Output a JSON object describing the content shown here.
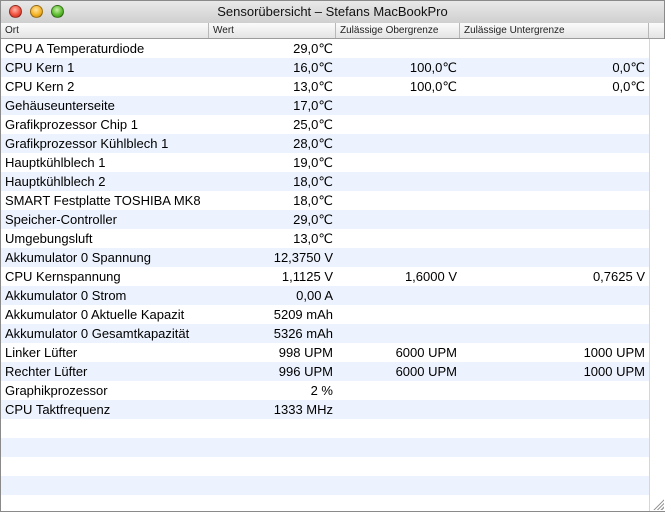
{
  "window": {
    "title": "Sensorübersicht – Stefans MacBookPro"
  },
  "columns": {
    "ort": "Ort",
    "wert": "Wert",
    "max": "Zulässige Obergrenze",
    "min": "Zulässige Untergrenze"
  },
  "rows": [
    {
      "name": "CPU A Temperaturdiode",
      "value": "29,0℃",
      "max": "",
      "min": ""
    },
    {
      "name": "CPU Kern 1",
      "value": "16,0℃",
      "max": "100,0℃",
      "min": "0,0℃"
    },
    {
      "name": "CPU Kern 2",
      "value": "13,0℃",
      "max": "100,0℃",
      "min": "0,0℃"
    },
    {
      "name": "Gehäuseunterseite",
      "value": "17,0℃",
      "max": "",
      "min": ""
    },
    {
      "name": "Grafikprozessor Chip 1",
      "value": "25,0℃",
      "max": "",
      "min": ""
    },
    {
      "name": "Grafikprozessor Kühlblech 1",
      "value": "28,0℃",
      "max": "",
      "min": ""
    },
    {
      "name": "Hauptkühlblech 1",
      "value": "19,0℃",
      "max": "",
      "min": ""
    },
    {
      "name": "Hauptkühlblech 2",
      "value": "18,0℃",
      "max": "",
      "min": ""
    },
    {
      "name": "SMART Festplatte TOSHIBA MK8",
      "value": "18,0℃",
      "max": "",
      "min": ""
    },
    {
      "name": "Speicher-Controller",
      "value": "29,0℃",
      "max": "",
      "min": ""
    },
    {
      "name": "Umgebungsluft",
      "value": "13,0℃",
      "max": "",
      "min": ""
    },
    {
      "name": "Akkumulator 0 Spannung",
      "value": "12,3750 V",
      "max": "",
      "min": ""
    },
    {
      "name": "CPU Kernspannung",
      "value": "1,1125 V",
      "max": "1,6000 V",
      "min": "0,7625 V"
    },
    {
      "name": "Akkumulator 0 Strom",
      "value": "0,00 A",
      "max": "",
      "min": ""
    },
    {
      "name": "Akkumulator 0 Aktuelle Kapazit",
      "value": "5209 mAh",
      "max": "",
      "min": ""
    },
    {
      "name": "Akkumulator 0 Gesamtkapazität",
      "value": "5326 mAh",
      "max": "",
      "min": ""
    },
    {
      "name": "Linker Lüfter",
      "value": "998 UPM",
      "max": "6000 UPM",
      "min": "1000 UPM"
    },
    {
      "name": "Rechter Lüfter",
      "value": "996 UPM",
      "max": "6000 UPM",
      "min": "1000 UPM"
    },
    {
      "name": "Graphikprozessor",
      "value": "2 %",
      "max": "",
      "min": ""
    },
    {
      "name": "CPU Taktfrequenz",
      "value": "1333 MHz",
      "max": "",
      "min": ""
    },
    {
      "name": "",
      "value": "",
      "max": "",
      "min": ""
    },
    {
      "name": "",
      "value": "",
      "max": "",
      "min": ""
    },
    {
      "name": "",
      "value": "",
      "max": "",
      "min": ""
    },
    {
      "name": "",
      "value": "",
      "max": "",
      "min": ""
    },
    {
      "name": "",
      "value": "",
      "max": "",
      "min": ""
    }
  ]
}
